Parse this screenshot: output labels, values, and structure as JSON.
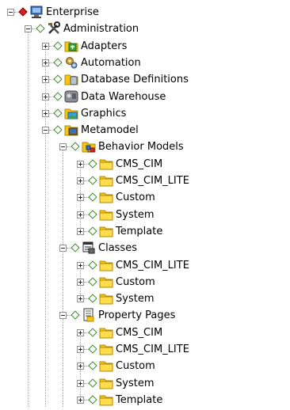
{
  "tree": [
    {
      "label": "Enterprise",
      "icon": "server-icon",
      "level": 0,
      "expander": "minus",
      "diamond": "red"
    },
    {
      "label": "Administration",
      "icon": "tools-icon",
      "level": 1,
      "expander": "minus",
      "diamond": "green"
    },
    {
      "label": "Adapters",
      "icon": "adapter-icon",
      "level": 2,
      "expander": "plus",
      "diamond": "green"
    },
    {
      "label": "Automation",
      "icon": "automation-gear-icon",
      "level": 2,
      "expander": "plus",
      "diamond": "green"
    },
    {
      "label": "Database Definitions",
      "icon": "database-folder-icon",
      "level": 2,
      "expander": "plus",
      "diamond": "green"
    },
    {
      "label": "Data Warehouse",
      "icon": "data-warehouse-icon",
      "level": 2,
      "expander": "plus",
      "diamond": "green"
    },
    {
      "label": "Graphics",
      "icon": "graphics-folder-icon",
      "level": 2,
      "expander": "plus",
      "diamond": "green"
    },
    {
      "label": "Metamodel",
      "icon": "metamodel-icon",
      "level": 2,
      "expander": "minus",
      "diamond": "green"
    },
    {
      "label": "Behavior Models",
      "icon": "behavior-models-icon",
      "level": 3,
      "expander": "minus",
      "diamond": "green"
    },
    {
      "label": "CMS_CIM",
      "icon": "folder-icon",
      "level": 4,
      "expander": "plus",
      "diamond": "green"
    },
    {
      "label": "CMS_CIM_LITE",
      "icon": "folder-icon",
      "level": 4,
      "expander": "plus",
      "diamond": "green"
    },
    {
      "label": "Custom",
      "icon": "folder-icon",
      "level": 4,
      "expander": "plus",
      "diamond": "green"
    },
    {
      "label": "System",
      "icon": "folder-icon",
      "level": 4,
      "expander": "plus",
      "diamond": "green"
    },
    {
      "label": "Template",
      "icon": "folder-icon",
      "level": 4,
      "expander": "plus",
      "diamond": "green"
    },
    {
      "label": "Classes",
      "icon": "classes-icon",
      "level": 3,
      "expander": "minus",
      "diamond": "green"
    },
    {
      "label": "CMS_CIM_LITE",
      "icon": "folder-icon",
      "level": 4,
      "expander": "plus",
      "diamond": "green"
    },
    {
      "label": "Custom",
      "icon": "folder-icon",
      "level": 4,
      "expander": "plus",
      "diamond": "green"
    },
    {
      "label": "System",
      "icon": "folder-icon",
      "level": 4,
      "expander": "plus",
      "diamond": "green"
    },
    {
      "label": "Property Pages",
      "icon": "property-pages-icon",
      "level": 3,
      "expander": "minus",
      "diamond": "green"
    },
    {
      "label": "CMS_CIM",
      "icon": "folder-icon",
      "level": 4,
      "expander": "plus",
      "diamond": "green"
    },
    {
      "label": "CMS_CIM_LITE",
      "icon": "folder-icon",
      "level": 4,
      "expander": "plus",
      "diamond": "green"
    },
    {
      "label": "Custom",
      "icon": "folder-icon",
      "level": 4,
      "expander": "plus",
      "diamond": "green"
    },
    {
      "label": "System",
      "icon": "folder-icon",
      "level": 4,
      "expander": "plus",
      "diamond": "green"
    },
    {
      "label": "Template",
      "icon": "folder-icon",
      "level": 4,
      "expander": "plus",
      "diamond": "green"
    }
  ],
  "colors": {
    "diamond_red": "#d81e1e",
    "diamond_green_border": "#3a8a2a",
    "folder_yellow": "#f5c518",
    "tree_line": "#a0a0a0"
  }
}
